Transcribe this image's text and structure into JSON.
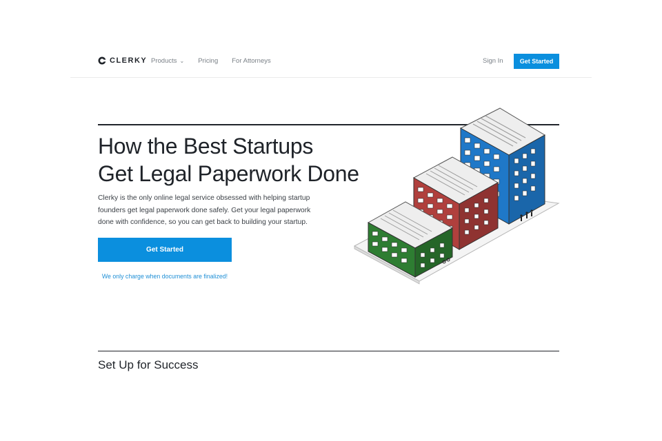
{
  "brand": {
    "name": "CLERKY",
    "logo_icon": "clerky-c-logo"
  },
  "nav": {
    "items": [
      {
        "label": "Products",
        "has_dropdown": true
      },
      {
        "label": "Pricing"
      },
      {
        "label": "For Attorneys"
      }
    ],
    "sign_in": "Sign In",
    "cta": "Get Started",
    "accent_color": "#0b8fde"
  },
  "hero": {
    "headline_line1": "How the Best Startups",
    "headline_line2": "Get Legal Paperwork Done",
    "lede": "Clerky is the only online legal service obsessed with helping startup founders get legal paperwork done safely. Get your legal paperwork done with confidence, so you can get back to building your startup.",
    "cta": "Get Started",
    "note": "We only charge when documents are finalized!",
    "illustration": "isometric-buildings-illustration",
    "building_colors": {
      "green": "#2e7d32",
      "red": "#b0403d",
      "blue": "#1f78c8"
    }
  },
  "next_section": {
    "title": "Set Up for Success"
  }
}
